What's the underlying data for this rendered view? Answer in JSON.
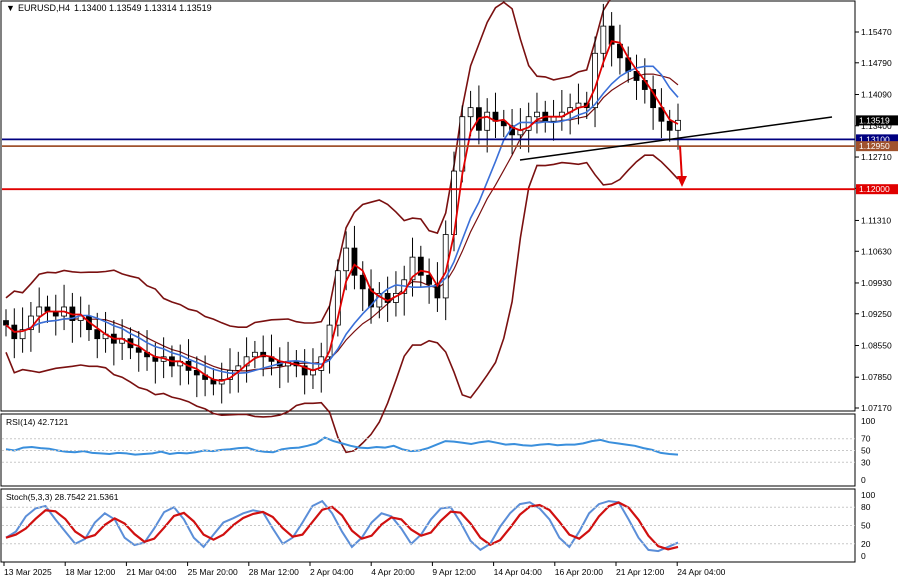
{
  "header": {
    "symbol": "EURUSD,H4",
    "ohlc": "1.13400 1.13549 1.13314 1.13519",
    "menu_glyph": "▼"
  },
  "colors": {
    "bull": "#8b0000",
    "bear": "#1a1a1a",
    "ma_fast": "#e00000",
    "ma_slow": "#3a6fd8",
    "bands": "#7a1010",
    "rsi": "#3a8fdc",
    "stoch_main": "#5b8ed8",
    "stoch_signal": "#d01010",
    "support": "#000080",
    "level_brown": "#a0522d",
    "target": "#e00000"
  },
  "price_axis": {
    "ticks": [
      "1.15470",
      "1.14790",
      "1.14090",
      "1.13400",
      "1.12710",
      "1.12020",
      "1.11310",
      "1.10630",
      "1.09930",
      "1.09250",
      "1.08550",
      "1.07850",
      "1.07170"
    ],
    "badges": [
      {
        "text": "1.13519",
        "bg": "#000000",
        "fg": "#ffffff"
      },
      {
        "text": "1.13100",
        "bg": "#000080",
        "fg": "#ffffff"
      },
      {
        "text": "1.12950",
        "bg": "#a0522d",
        "fg": "#ffffff"
      },
      {
        "text": "1.12000",
        "bg": "#e00000",
        "fg": "#ffffff"
      }
    ]
  },
  "rsi_panel": {
    "label": "RSI(14) 42.7121",
    "ticks": [
      "100",
      "70",
      "50",
      "30",
      "0"
    ]
  },
  "stoch_panel": {
    "label": "Stoch(5,3,3) 28.7542 21.5361",
    "ticks": [
      "100",
      "80",
      "50",
      "20",
      "0"
    ]
  },
  "time_axis": [
    "13 Mar 2025",
    "18 Mar 12:00",
    "21 Mar 04:00",
    "25 Mar 20:00",
    "28 Mar 12:00",
    "2 Apr 04:00",
    "4 Apr 20:00",
    "9 Apr 12:00",
    "14 Apr 04:00",
    "16 Apr 20:00",
    "21 Apr 12:00",
    "24 Apr 04:00"
  ],
  "chart_data": {
    "type": "line",
    "subtype": "candlestick",
    "title": "EURUSD,H4",
    "xlabel": "",
    "ylabel": "",
    "ylim": [
      1.0705,
      1.1615
    ],
    "horizontal_levels": [
      1.131,
      1.1295,
      1.12
    ],
    "last_price": 1.13519,
    "series": [
      {
        "name": "Close",
        "values": [
          1.09,
          1.087,
          1.089,
          1.092,
          1.094,
          1.093,
          1.092,
          1.094,
          1.091,
          1.092,
          1.089,
          1.087,
          1.088,
          1.086,
          1.087,
          1.085,
          1.084,
          1.083,
          1.082,
          1.083,
          1.081,
          1.082,
          1.08,
          1.079,
          1.078,
          1.077,
          1.078,
          1.08,
          1.081,
          1.083,
          1.084,
          1.083,
          1.082,
          1.081,
          1.082,
          1.081,
          1.079,
          1.08,
          1.083,
          1.09,
          1.102,
          1.107,
          1.101,
          1.098,
          1.094,
          1.097,
          1.095,
          1.097,
          1.1,
          1.105,
          1.101,
          1.099,
          1.096,
          1.11,
          1.124,
          1.136,
          1.138,
          1.133,
          1.137,
          1.135,
          1.134,
          1.132,
          1.133,
          1.136,
          1.137,
          1.135,
          1.136,
          1.137,
          1.138,
          1.139,
          1.138,
          1.15,
          1.156,
          1.152,
          1.149,
          1.146,
          1.144,
          1.142,
          1.138,
          1.135,
          1.133,
          1.1352
        ]
      },
      {
        "name": "RSI",
        "values": [
          52,
          50,
          55,
          56,
          54,
          53,
          50,
          48,
          47,
          49,
          46,
          45,
          44,
          46,
          45,
          43,
          44,
          45,
          48,
          44,
          46,
          45,
          47,
          50,
          49,
          51,
          52,
          54,
          55,
          50,
          48,
          47,
          52,
          54,
          55,
          58,
          62,
          72,
          66,
          62,
          58,
          55,
          54,
          56,
          55,
          58,
          52,
          49,
          50,
          54,
          60,
          66,
          65,
          63,
          61,
          64,
          66,
          63,
          60,
          61,
          59,
          58,
          60,
          61,
          59,
          60,
          60,
          62,
          66,
          68,
          64,
          62,
          60,
          58,
          54,
          51,
          46,
          44,
          43
        ]
      },
      {
        "name": "Stoch",
        "values": [
          30,
          40,
          65,
          78,
          82,
          60,
          40,
          20,
          28,
          55,
          70,
          60,
          30,
          18,
          22,
          45,
          72,
          80,
          60,
          30,
          15,
          35,
          55,
          62,
          70,
          75,
          72,
          45,
          20,
          30,
          55,
          82,
          90,
          70,
          40,
          15,
          30,
          55,
          70,
          65,
          45,
          20,
          35,
          60,
          78,
          80,
          55,
          25,
          10,
          20,
          48,
          70,
          85,
          88,
          78,
          60,
          30,
          15,
          40,
          70,
          85,
          90,
          88,
          60,
          30,
          10,
          8,
          15,
          22
        ]
      }
    ]
  }
}
